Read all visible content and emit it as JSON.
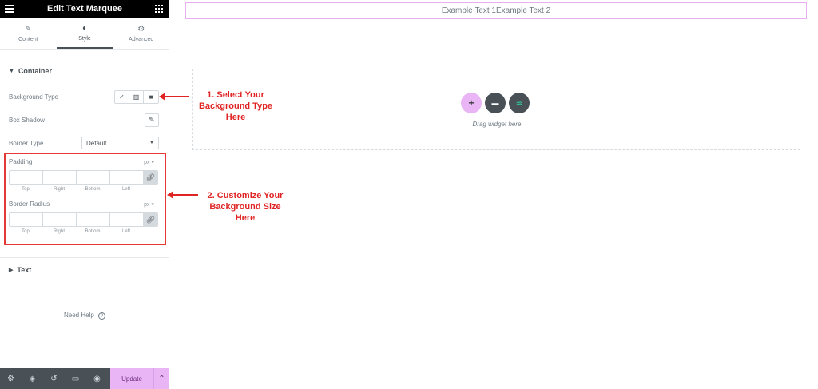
{
  "header": {
    "title": "Edit Text Marquee"
  },
  "tabs": [
    {
      "label": "Content",
      "icon": "pencil-icon"
    },
    {
      "label": "Style",
      "icon": "contrast-icon"
    },
    {
      "label": "Advanced",
      "icon": "gear-icon"
    }
  ],
  "container_section": {
    "title": "Container",
    "background_type_label": "Background Type",
    "box_shadow_label": "Box Shadow",
    "border_type_label": "Border Type",
    "border_type_value": "Default",
    "padding_label": "Padding",
    "padding_unit": "px",
    "border_radius_label": "Border Radius",
    "border_radius_unit": "px",
    "dimension_names": [
      "Top",
      "Right",
      "Bottom",
      "Left"
    ]
  },
  "text_section": {
    "title": "Text"
  },
  "help": {
    "label": "Need Help"
  },
  "bottombar": {
    "update_label": "Update"
  },
  "canvas": {
    "marquee_text": "Example Text 1Example Text 2",
    "drag_text": "Drag widget here"
  },
  "annotations": {
    "callout1": [
      "1. Select Your",
      "Background Type",
      "Here"
    ],
    "callout2": [
      "2. Customize Your",
      "Background Size",
      "Here"
    ]
  },
  "colors": {
    "accent_pink": "#e9b5f5",
    "annotation_red": "#e02424",
    "topbar": "#000000",
    "bottombar": "#495157"
  }
}
